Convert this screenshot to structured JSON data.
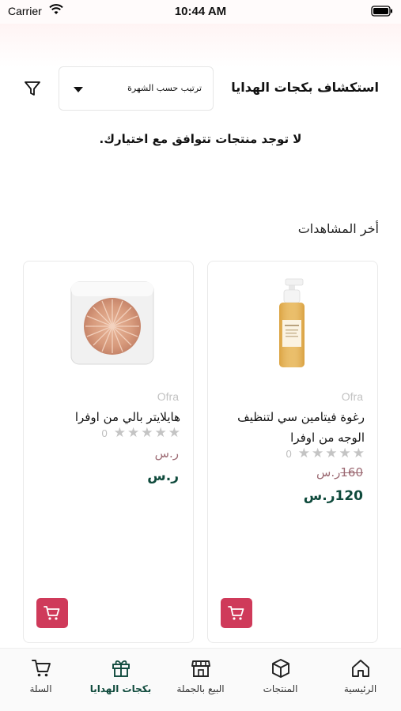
{
  "status_bar": {
    "carrier": "Carrier",
    "time": "10:44 AM"
  },
  "header": {
    "title": "استكشاف بكجات الهدايا",
    "sort_label": "ترتيب حسب الشهرة"
  },
  "empty_message": "لا توجد منتجات تتوافق مع اختيارك.",
  "recently_viewed": {
    "title": "أخر المشاهدات",
    "products": [
      {
        "brand": "Ofra",
        "name": "رغوة فيتامين سي لتنظيف الوجه من اوفرا",
        "rating": 0,
        "rating_count": "0",
        "old_price_value": "160",
        "old_price_currency": "ر.س",
        "price_value": "120",
        "price_currency": "ر.س"
      },
      {
        "brand": "Ofra",
        "name": "هايلايتر بالي من اوفرا",
        "rating": 0,
        "rating_count": "0",
        "old_price_value": "",
        "old_price_currency": "ر.س",
        "price_value": "",
        "price_currency": "ر.س"
      }
    ]
  },
  "tabs": [
    {
      "label": "الرئيسية",
      "icon": "home-icon"
    },
    {
      "label": "المنتجات",
      "icon": "box-icon"
    },
    {
      "label": "البيع بالجملة",
      "icon": "store-icon"
    },
    {
      "label": "بكجات الهدايا",
      "icon": "gift-icon",
      "active": true
    },
    {
      "label": "السلة",
      "icon": "cart-icon"
    }
  ],
  "colors": {
    "accent": "#0f4a3c",
    "cart_button": "#cf3a5a",
    "old_price": "#9c6a73"
  }
}
